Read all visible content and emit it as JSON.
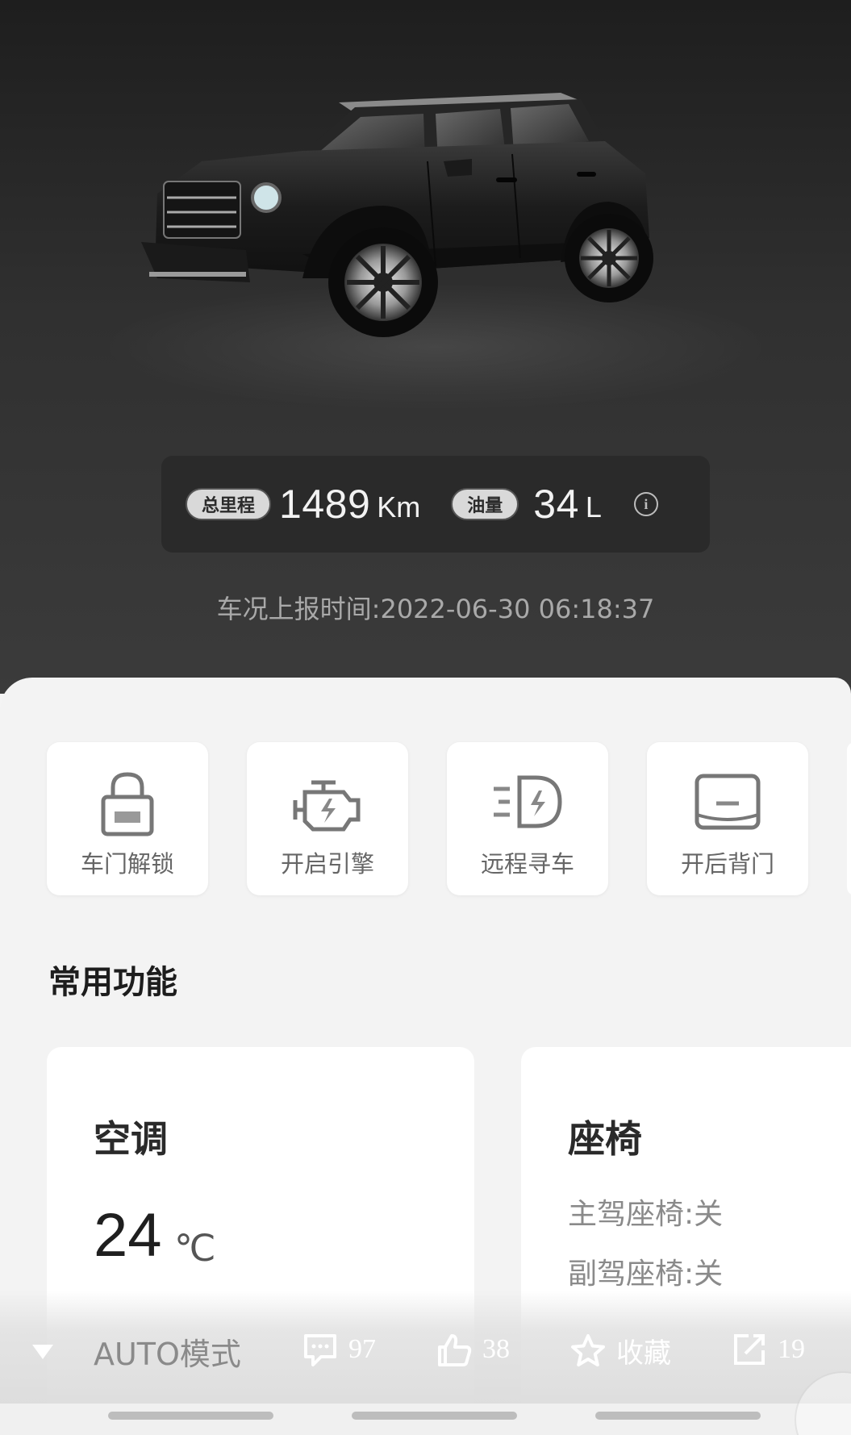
{
  "vehicle": {
    "mileage_label": "总里程",
    "mileage_value": "1489",
    "mileage_unit": "Km",
    "fuel_label": "油量",
    "fuel_value": "34",
    "fuel_unit": "L",
    "report_time": "车况上报时间:2022-06-30 06:18:37",
    "body_color": "#1f1f1f"
  },
  "quick_actions": [
    {
      "label": "车门解锁",
      "icon": "lock-icon"
    },
    {
      "label": "开启引擎",
      "icon": "engine-icon"
    },
    {
      "label": "远程寻车",
      "icon": "headlight-icon"
    },
    {
      "label": "开后背门",
      "icon": "tailgate-icon"
    }
  ],
  "section": {
    "title": "常用功能"
  },
  "climate": {
    "title": "空调",
    "temperature": "24",
    "unit": "℃",
    "mode": "AUTO模式"
  },
  "seat": {
    "title": "座椅",
    "driver": "主驾座椅:关",
    "passenger": "副驾座椅:关"
  },
  "social": {
    "comments": "97",
    "likes": "38",
    "favorite_label": "收藏",
    "shares": "19"
  },
  "colors": {
    "hero_bg": "#2b2b2b",
    "panel_bg": "#f3f3f3",
    "card_bg": "#ffffff"
  }
}
